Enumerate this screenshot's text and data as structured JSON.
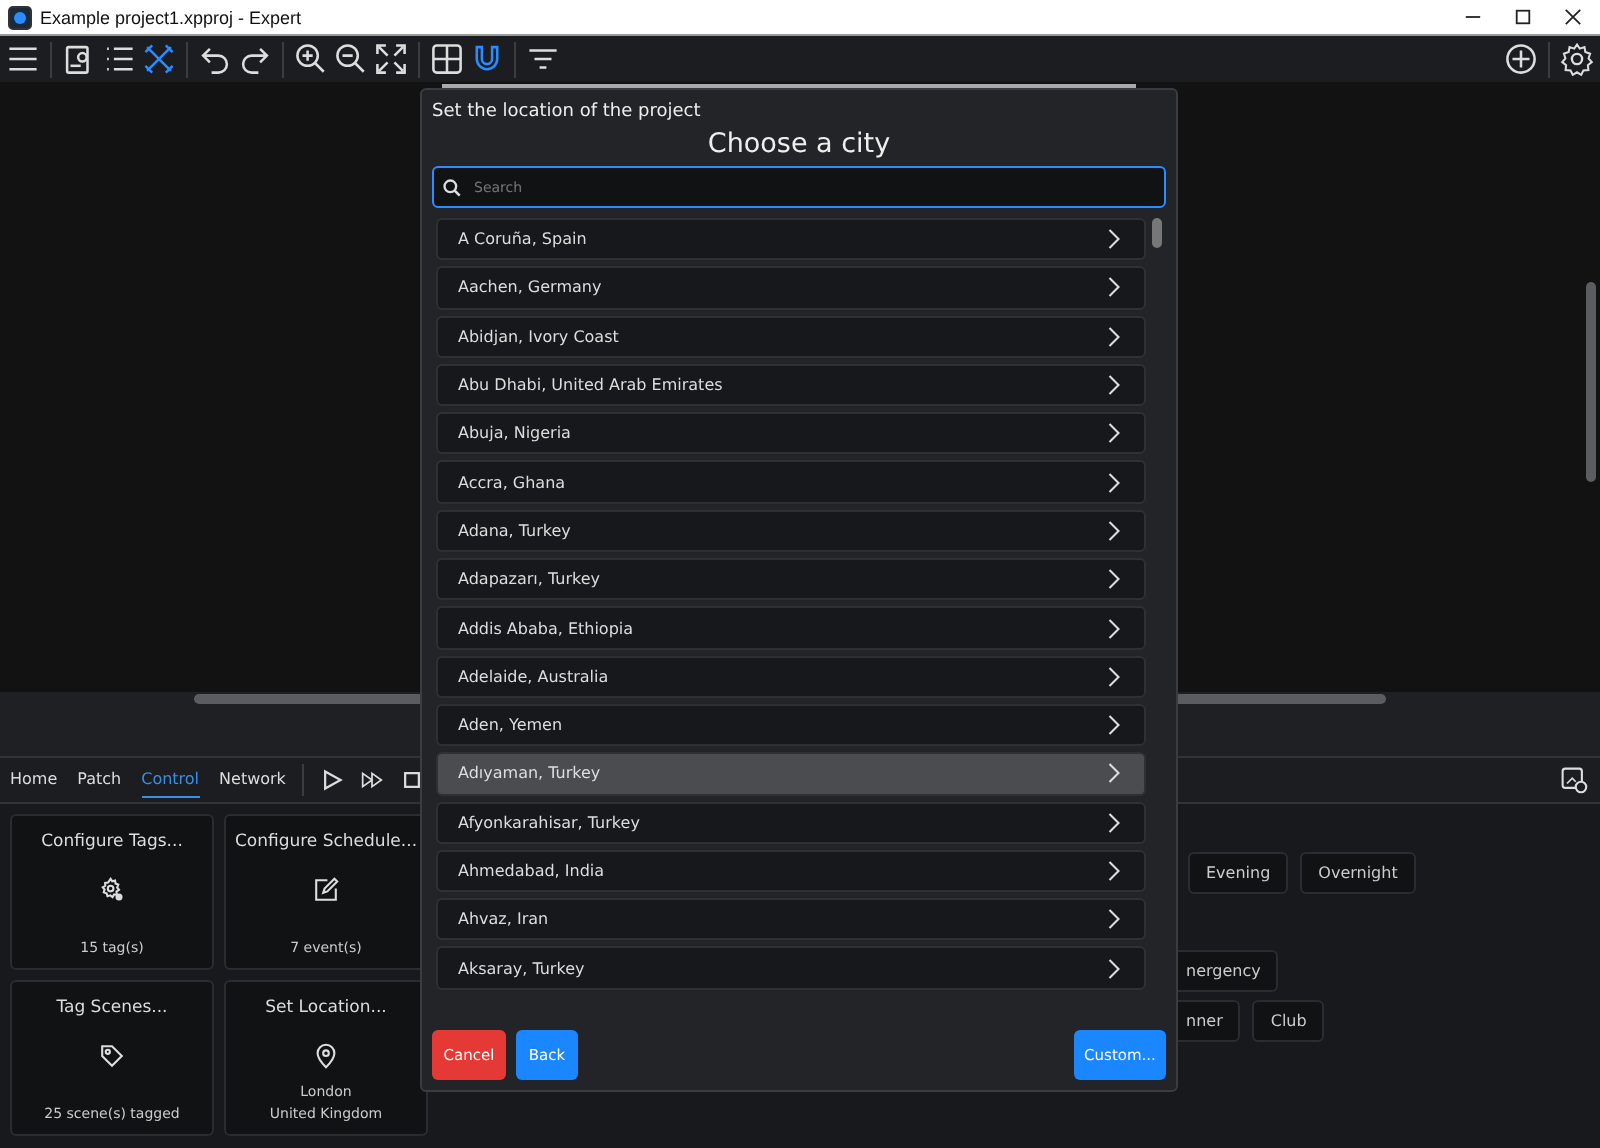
{
  "window": {
    "title": "Example project1.xpproj - Expert"
  },
  "toolbar": [
    {
      "kind": "menu",
      "on": false
    },
    {
      "kind": "sep"
    },
    {
      "kind": "clipboard",
      "on": false
    },
    {
      "kind": "list",
      "on": false
    },
    {
      "kind": "tools",
      "on": true
    },
    {
      "kind": "sep"
    },
    {
      "kind": "undo",
      "on": false
    },
    {
      "kind": "redo",
      "on": false
    },
    {
      "kind": "sep"
    },
    {
      "kind": "zoom-in",
      "on": false
    },
    {
      "kind": "zoom-out",
      "on": false
    },
    {
      "kind": "fit",
      "on": false
    },
    {
      "kind": "sep"
    },
    {
      "kind": "grid",
      "on": false
    },
    {
      "kind": "magnet",
      "on": true
    },
    {
      "kind": "sep"
    },
    {
      "kind": "filter",
      "on": false
    }
  ],
  "panel": {
    "tabs": [
      {
        "label": "Home",
        "selected": false
      },
      {
        "label": "Patch",
        "selected": false
      },
      {
        "label": "Control",
        "selected": true
      },
      {
        "label": "Network",
        "selected": false
      }
    ],
    "cards": [
      {
        "title": "Configure Tags...",
        "kind": "tag-gear",
        "caption": [
          "15 tag(s)"
        ]
      },
      {
        "title": "Configure Schedule...",
        "kind": "edit",
        "caption": [
          "7 event(s)"
        ]
      },
      {
        "title": "Tag Scenes...",
        "kind": "tag",
        "caption": [
          "25 scene(s) tagged"
        ]
      },
      {
        "title": "Set Location...",
        "kind": "pin",
        "caption": [
          "London",
          "United Kingdom"
        ]
      }
    ],
    "button_rows": [
      [
        "Evening",
        "Overnight"
      ],
      [
        "nergency"
      ],
      [
        "nner",
        "Club"
      ]
    ]
  },
  "dialog": {
    "caption": "Set the location of the project",
    "title": "Choose a city",
    "search": {
      "placeholder": "Search"
    },
    "cities": [
      {
        "name": "A Coruña, Spain",
        "selected": false
      },
      {
        "name": "Aachen, Germany",
        "selected": false
      },
      {
        "name": "Abidjan, Ivory Coast",
        "selected": false
      },
      {
        "name": "Abu Dhabi, United Arab Emirates",
        "selected": false
      },
      {
        "name": "Abuja, Nigeria",
        "selected": false
      },
      {
        "name": "Accra, Ghana",
        "selected": false
      },
      {
        "name": "Adana, Turkey",
        "selected": false
      },
      {
        "name": "Adapazarı, Turkey",
        "selected": false
      },
      {
        "name": "Addis Ababa, Ethiopia",
        "selected": false
      },
      {
        "name": "Adelaide, Australia",
        "selected": false
      },
      {
        "name": "Aden, Yemen",
        "selected": false
      },
      {
        "name": "Adıyaman, Turkey",
        "selected": true
      },
      {
        "name": "Afyonkarahisar, Turkey",
        "selected": false
      },
      {
        "name": "Ahmedabad, India",
        "selected": false
      },
      {
        "name": "Ahvaz, Iran",
        "selected": false
      },
      {
        "name": "Aksaray, Turkey",
        "selected": false
      }
    ],
    "buttons": [
      {
        "label": "Cancel",
        "kind": "danger"
      },
      {
        "label": "Back",
        "kind": "primary"
      },
      {
        "label": "Custom...",
        "kind": "primary-right"
      }
    ]
  }
}
